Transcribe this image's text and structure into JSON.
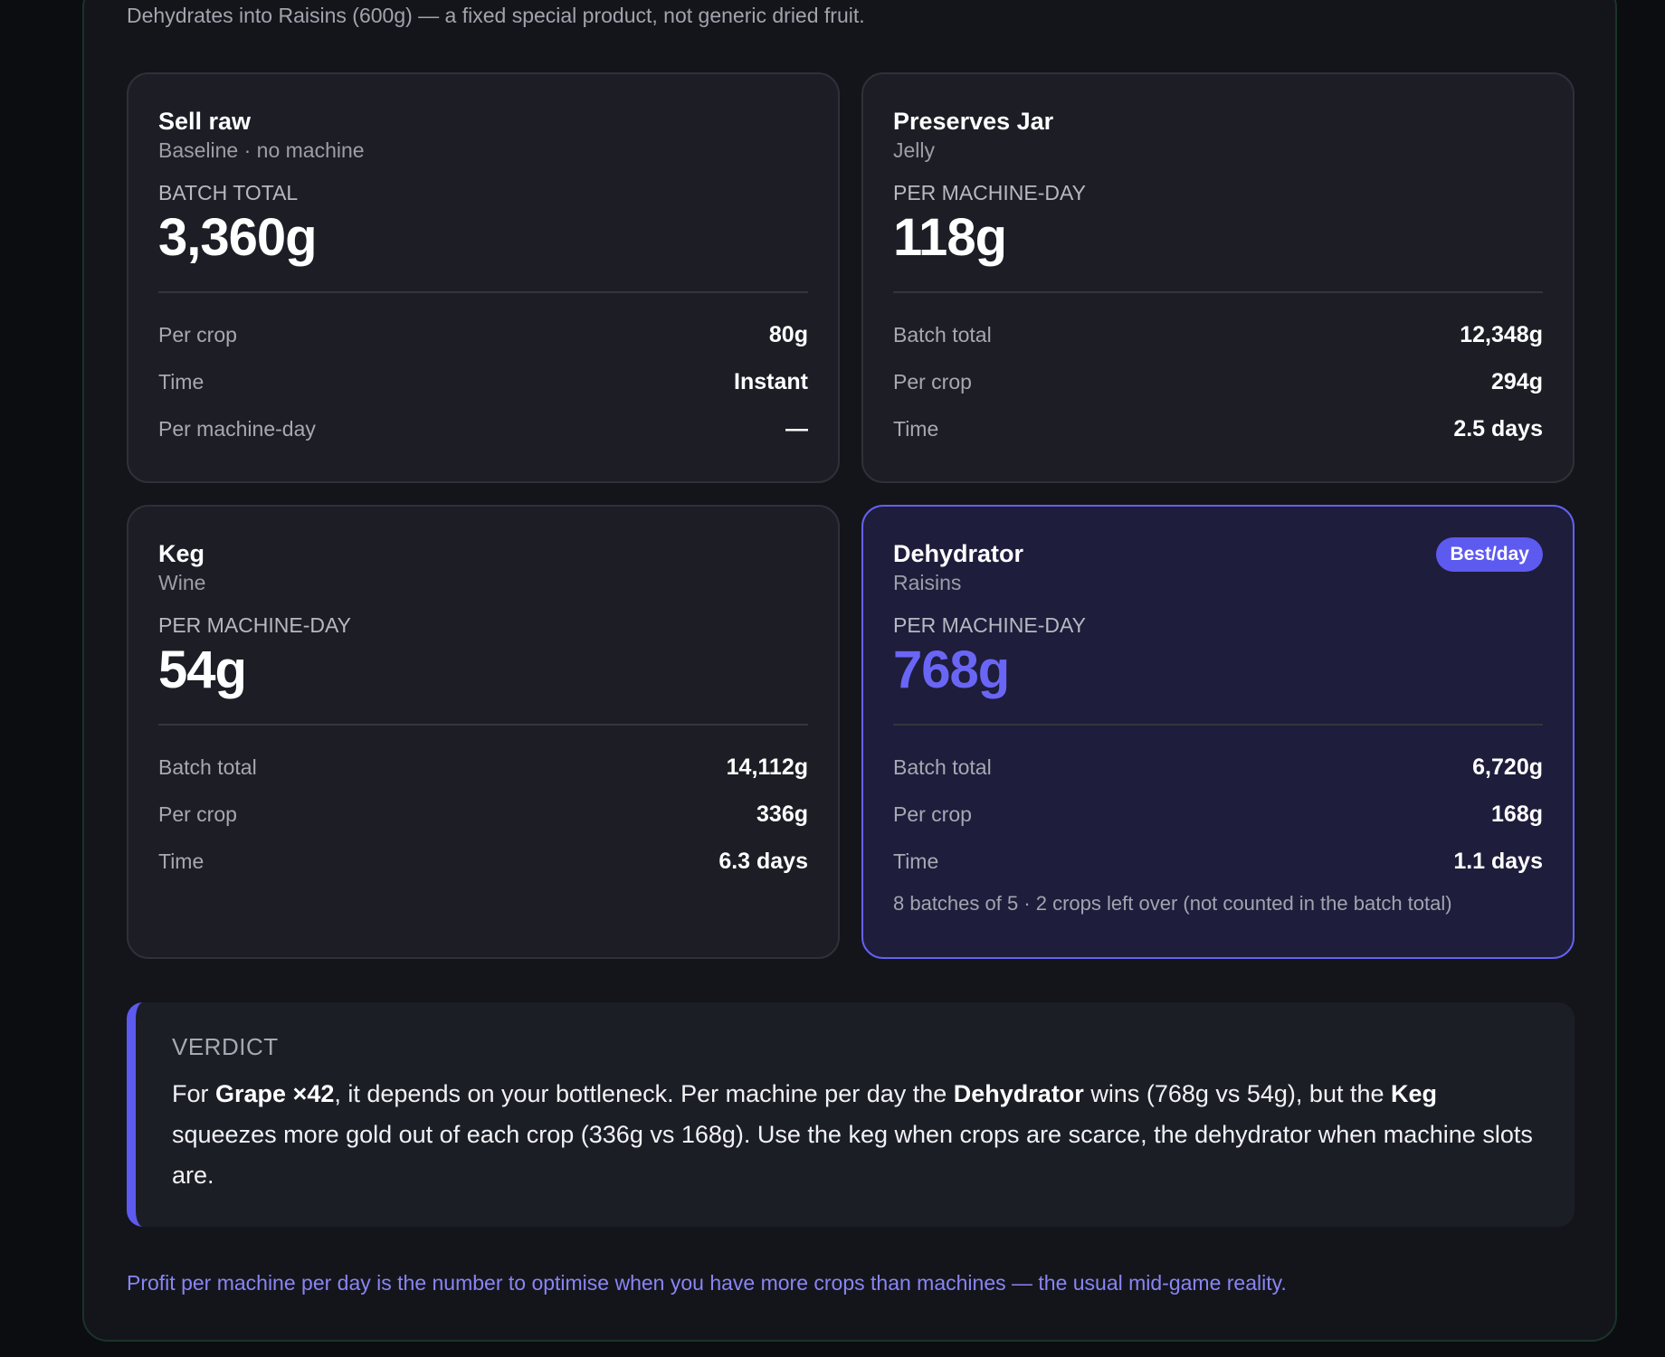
{
  "intro_text": "Dehydrates into Raisins (600g) — a fixed special product, not generic dried fruit.",
  "cards": [
    {
      "title": "Sell raw",
      "subtitle": "Baseline · no machine",
      "metric_label": "BATCH TOTAL",
      "metric_value": "3,360g",
      "rows": [
        {
          "label": "Per crop",
          "value": "80g"
        },
        {
          "label": "Time",
          "value": "Instant"
        },
        {
          "label": "Per machine-day",
          "value": "—"
        }
      ]
    },
    {
      "title": "Preserves Jar",
      "subtitle": "Jelly",
      "metric_label": "PER MACHINE-DAY",
      "metric_value": "118g",
      "rows": [
        {
          "label": "Batch total",
          "value": "12,348g"
        },
        {
          "label": "Per crop",
          "value": "294g"
        },
        {
          "label": "Time",
          "value": "2.5 days"
        }
      ]
    },
    {
      "title": "Keg",
      "subtitle": "Wine",
      "metric_label": "PER MACHINE-DAY",
      "metric_value": "54g",
      "rows": [
        {
          "label": "Batch total",
          "value": "14,112g"
        },
        {
          "label": "Per crop",
          "value": "336g"
        },
        {
          "label": "Time",
          "value": "6.3 days"
        }
      ]
    },
    {
      "title": "Dehydrator",
      "subtitle": "Raisins",
      "badge": "Best/day",
      "metric_label": "PER MACHINE-DAY",
      "metric_value": "768g",
      "rows": [
        {
          "label": "Batch total",
          "value": "6,720g"
        },
        {
          "label": "Per crop",
          "value": "168g"
        },
        {
          "label": "Time",
          "value": "1.1 days"
        }
      ],
      "footnote": "8 batches of 5 · 2 crops left over (not counted in the batch total)"
    }
  ],
  "verdict": {
    "label": "VERDICT",
    "t1": "For ",
    "b1": "Grape ×42",
    "t2": ", it depends on your bottleneck. Per machine per day the ",
    "b2": "Dehydrator",
    "t3": " wins (768g vs 54g), but the ",
    "b3": "Keg",
    "t4": " squeezes more gold out of each crop (336g vs 168g). Use the keg when crops are scarce, the dehydrator when machine slots are."
  },
  "tip": "Profit per machine per day is the number to optimise when you have more crops than machines — the usual mid-game reality.",
  "colors": {
    "accent": "#5d5af0",
    "panel_border": "#1b3428",
    "card_bg": "#1c1d25",
    "best_card_bg": "#1e1d3b"
  }
}
